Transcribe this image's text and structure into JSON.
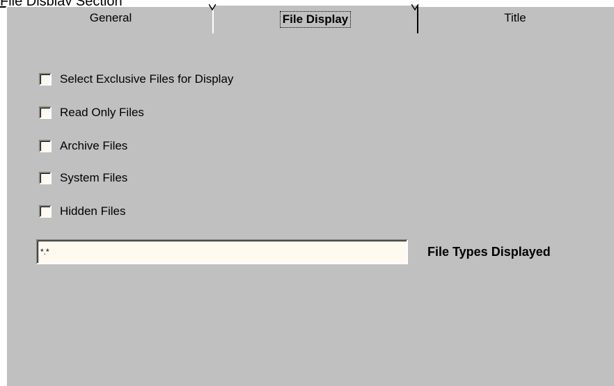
{
  "heading": "File Display Section",
  "tabs": [
    {
      "label": "General",
      "active": false
    },
    {
      "label": "File Display",
      "active": true
    },
    {
      "label": "Title",
      "active": false
    }
  ],
  "checkboxes": [
    {
      "label": "Select Exclusive Files for Display",
      "checked": false
    },
    {
      "label": "Read Only Files",
      "checked": false
    },
    {
      "label": "Archive Files",
      "checked": false
    },
    {
      "label": "System Files",
      "checked": false
    },
    {
      "label": "Hidden Files",
      "checked": false
    }
  ],
  "file_types": {
    "value": "*.*",
    "label": "File Types Displayed"
  },
  "colors": {
    "panel": "#c0c0c0",
    "field_bg": "#fffaf0"
  }
}
